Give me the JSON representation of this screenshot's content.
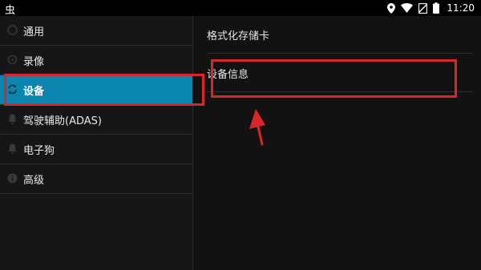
{
  "statusbar": {
    "left_glyph": "虫",
    "time": "11:20",
    "icons": [
      "location-icon",
      "wifi-icon",
      "no-sim-icon",
      "battery-icon"
    ]
  },
  "settings_menu": {
    "items": [
      {
        "label": "通用",
        "icon": "settings-icon"
      },
      {
        "label": "录像",
        "icon": "video-icon"
      },
      {
        "label": "设备",
        "icon": "sync-icon",
        "selected": true
      },
      {
        "label": "驾驶辅助(ADAS)",
        "icon": "bell-icon"
      },
      {
        "label": "电子狗",
        "icon": "bell-icon"
      },
      {
        "label": "高级",
        "icon": "info-icon"
      }
    ]
  },
  "detail_pane": {
    "items": [
      {
        "label": "格式化存储卡"
      },
      {
        "label": "设备信息"
      }
    ]
  },
  "annotation_color": "#d9262b",
  "accent_color": "#0a85ad"
}
